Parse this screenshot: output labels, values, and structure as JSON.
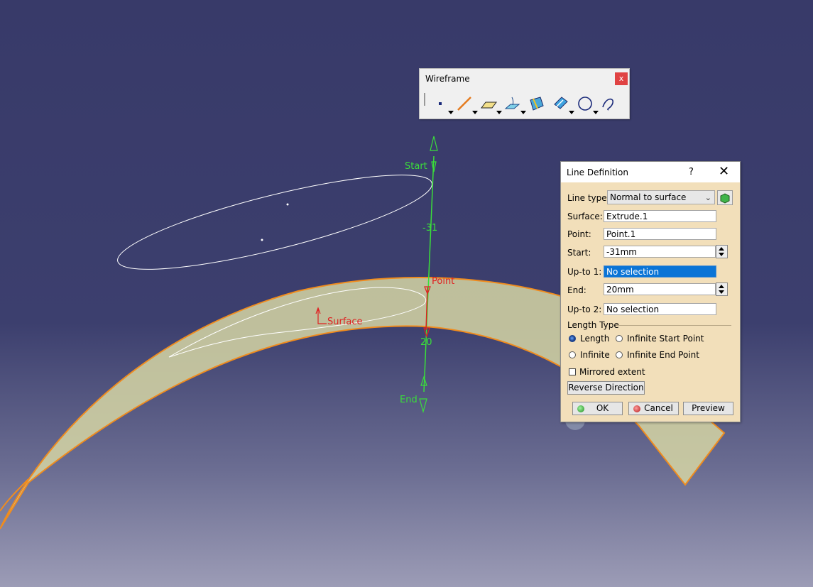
{
  "toolbar": {
    "title": "Wireframe",
    "close": "x",
    "icons": [
      "point-icon",
      "line-icon",
      "plane-icon",
      "projection-icon",
      "intersection-icon",
      "offset-icon",
      "circle-icon",
      "spline-icon"
    ]
  },
  "scene": {
    "start_label": "Start",
    "end_label": "End",
    "point_label": "Point",
    "surface_label": "Surface",
    "start_value": "-31",
    "end_value": "20",
    "colors": {
      "background": "#3a3c6b",
      "line": "#3adf3a",
      "surface": "#dcdcaa",
      "edge": "#f08c1e",
      "label_red": "#e02020"
    }
  },
  "dialog": {
    "title": "Line Definition",
    "help": "?",
    "close": "✕",
    "line_type_label": "Line type :",
    "line_type_value": "Normal to surface",
    "surface_label": "Surface:",
    "surface_value": "Extrude.1",
    "point_label": "Point:",
    "point_value": "Point.1",
    "start_label": "Start:",
    "start_value": "-31mm",
    "upto1_label": "Up-to 1:",
    "upto1_value": "No selection",
    "end_label": "End:",
    "end_value": "20mm",
    "upto2_label": "Up-to 2:",
    "upto2_value": "No selection",
    "length_type_label": "Length Type",
    "options": {
      "length": "Length",
      "infinite_start": "Infinite Start Point",
      "infinite": "Infinite",
      "infinite_end": "Infinite End Point"
    },
    "selected_option": "Length",
    "mirrored_label": "Mirrored extent",
    "mirrored_checked": false,
    "reverse_label": "Reverse Direction",
    "ok_label": "OK",
    "cancel_label": "Cancel",
    "preview_label": "Preview"
  }
}
